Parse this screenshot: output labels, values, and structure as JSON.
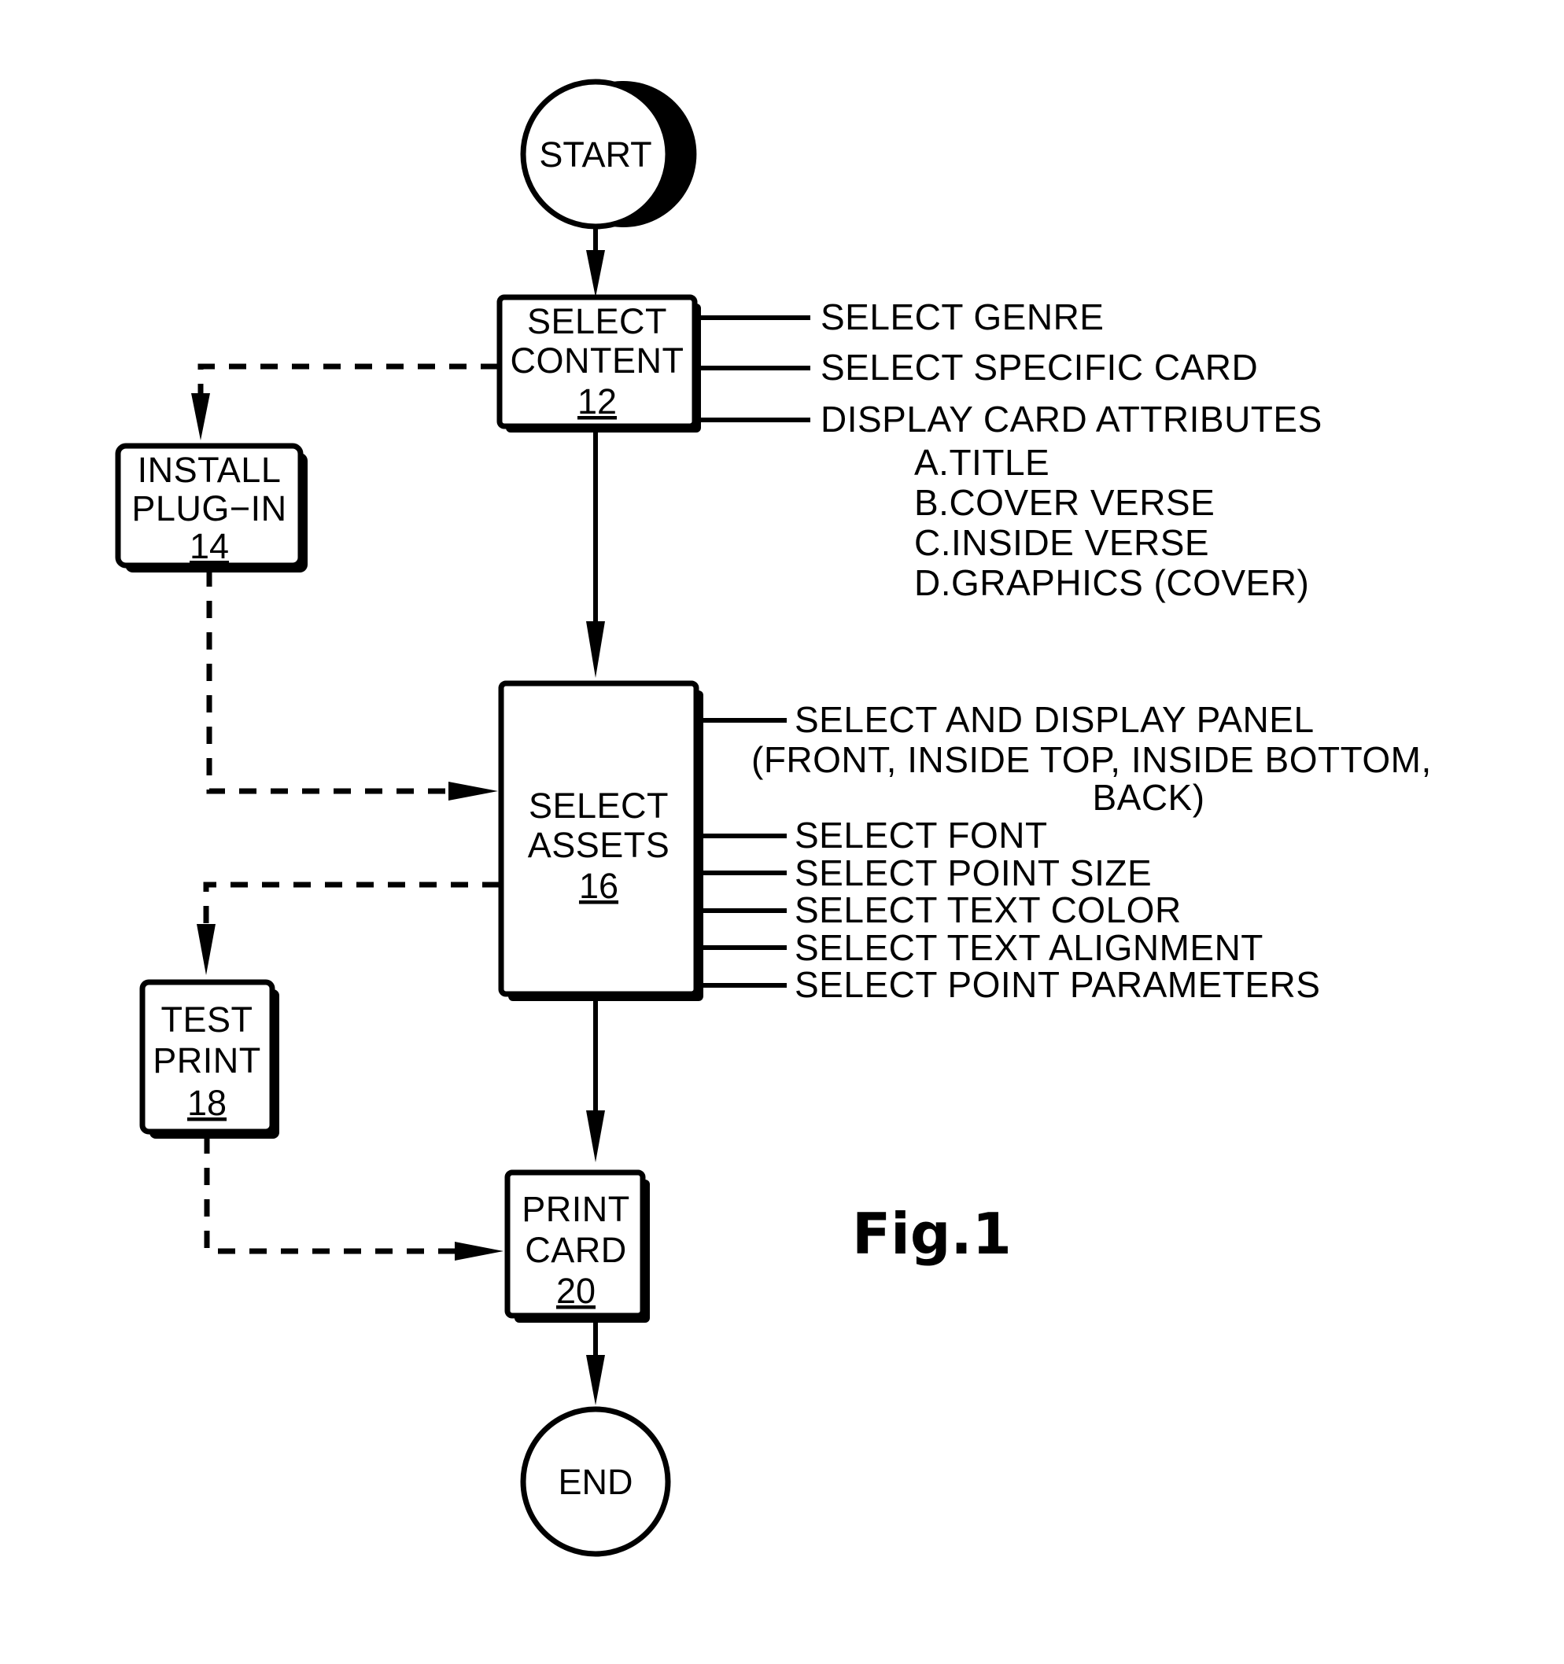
{
  "figure": {
    "caption": "Fig.1",
    "type": "patent-flowchart"
  },
  "nodes": {
    "start": {
      "label": "START",
      "shape": "circle"
    },
    "select_content": {
      "line1": "SELECT",
      "line2": "CONTENT",
      "ref": "12",
      "shape": "rect"
    },
    "install_plugin": {
      "line1": "INSTALL",
      "line2": "PLUG−IN",
      "ref": "14",
      "shape": "rect"
    },
    "select_assets": {
      "line1": "SELECT",
      "line2": "ASSETS",
      "ref": "16",
      "shape": "rect"
    },
    "test_print": {
      "line1": "TEST",
      "line2": "PRINT",
      "ref": "18",
      "shape": "rect"
    },
    "print_card": {
      "line1": "PRINT",
      "line2": "CARD",
      "ref": "20",
      "shape": "rect"
    },
    "end": {
      "label": "END",
      "shape": "circle"
    }
  },
  "annotations": {
    "select_content": [
      "SELECT  GENRE",
      "SELECT  SPECIFIC  CARD",
      "DISPLAY  CARD  ATTRIBUTES"
    ],
    "card_attributes": [
      "A.TITLE",
      "B.COVER  VERSE",
      "C.INSIDE  VERSE",
      "D.GRAPHICS  (COVER)"
    ],
    "select_assets": {
      "panel_line1": "SELECT  AND  DISPLAY  PANEL",
      "panel_line2": "(FRONT,  INSIDE  TOP,  INSIDE  BOTTOM,",
      "panel_line3": "BACK)",
      "items": [
        "SELECT  FONT",
        "SELECT  POINT  SIZE",
        "SELECT  TEXT  COLOR",
        "SELECT  TEXT  ALIGNMENT",
        "SELECT  POINT  PARAMETERS"
      ]
    }
  },
  "colors": {
    "ink": "#000000",
    "paper": "#ffffff"
  }
}
